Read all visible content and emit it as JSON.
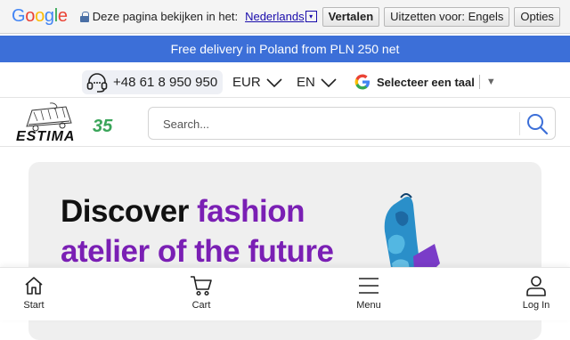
{
  "translate_bar": {
    "logo": "Google",
    "prompt": "Deze pagina bekijken in het:",
    "language": "Nederlands",
    "dropdown_glyph": "▾",
    "translate_button": "Vertalen",
    "off_button": "Uitzetten voor: Engels",
    "options_button": "Opties"
  },
  "promo": {
    "text": "Free delivery in Poland from PLN 250 net"
  },
  "utility": {
    "phone": "+48 61 8 950 950",
    "currency": "EUR",
    "language": "EN",
    "translate_widget": "Selecteer een taal",
    "translate_arrow": "▼"
  },
  "header": {
    "logo_text": "ESTIMA",
    "logo_badge": "35",
    "search_placeholder": "Search..."
  },
  "banner": {
    "line1_plain": "Discover ",
    "line1_accent": "fashion",
    "line2": "atelier of the future"
  },
  "bottom_nav": {
    "items": [
      {
        "label": "Start",
        "icon": "home-icon"
      },
      {
        "label": "Cart",
        "icon": "cart-icon"
      },
      {
        "label": "Menu",
        "icon": "menu-icon"
      },
      {
        "label": "Log In",
        "icon": "user-icon"
      }
    ]
  },
  "colors": {
    "promo_bg": "#3c6fd8",
    "accent_purple": "#7a1fb4",
    "search_icon": "#3c6fd8",
    "logo_green": "#3aa55a"
  }
}
